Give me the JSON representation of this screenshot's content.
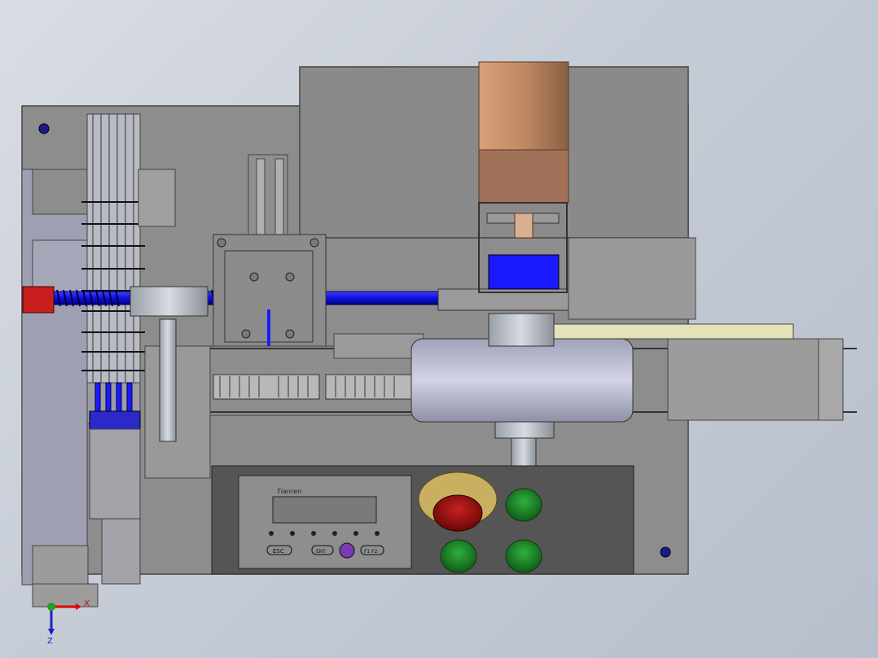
{
  "panel": {
    "brand": "Tianren",
    "key_esc": "ESC",
    "key_ent": "ENT",
    "key_mid": "F1 F2"
  },
  "triad": {
    "x_label": "X",
    "z_label": "Z"
  },
  "colors": {
    "background": "#c6ccd6",
    "frame": "#8c8c8c",
    "screw_blue": "#1a1aff",
    "coupling_red": "#c81e1e",
    "motor_copper": "#c08a63",
    "button_green": "#1f8a2a",
    "estop_red": "#a81212",
    "estop_yellow": "#c8b060"
  }
}
